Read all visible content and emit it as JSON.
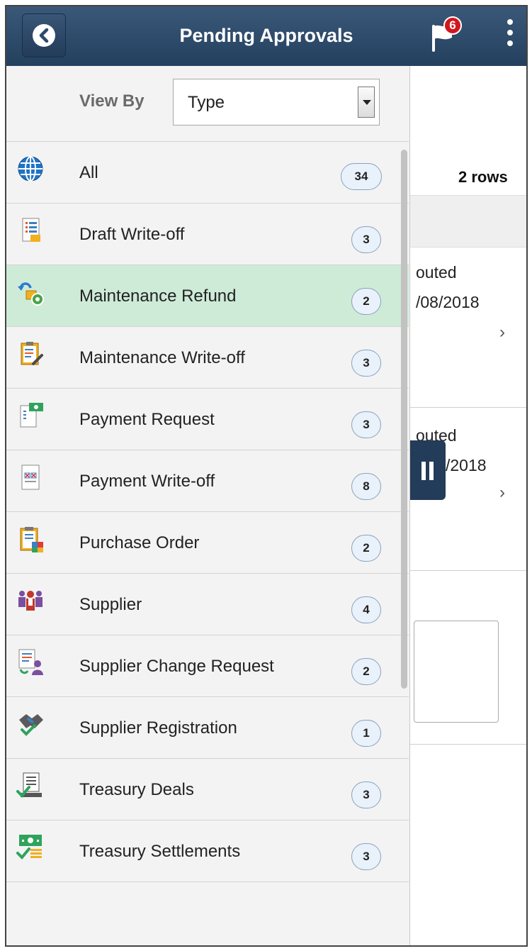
{
  "header": {
    "title": "Pending Approvals",
    "notification_count": "6"
  },
  "view_by": {
    "label": "View By",
    "selected": "Type"
  },
  "background": {
    "rows_count": "2 rows",
    "row1_line1": "outed",
    "row1_line2": "/08/2018",
    "row2_line1": "outed",
    "row2_line2": "/2018"
  },
  "items": [
    {
      "label": "All",
      "count": "34",
      "icon": "globe-icon"
    },
    {
      "label": "Draft Write-off",
      "count": "3",
      "icon": "document-list-icon"
    },
    {
      "label": "Maintenance Refund",
      "count": "2",
      "icon": "refund-icon",
      "selected": true
    },
    {
      "label": "Maintenance Write-off",
      "count": "3",
      "icon": "clipboard-wrench-icon"
    },
    {
      "label": "Payment Request",
      "count": "3",
      "icon": "payment-request-icon"
    },
    {
      "label": "Payment Write-off",
      "count": "8",
      "icon": "payment-writeoff-icon"
    },
    {
      "label": "Purchase Order",
      "count": "2",
      "icon": "purchase-order-icon"
    },
    {
      "label": "Supplier",
      "count": "4",
      "icon": "supplier-group-icon"
    },
    {
      "label": "Supplier Change Request",
      "count": "2",
      "icon": "supplier-change-icon"
    },
    {
      "label": "Supplier Registration",
      "count": "1",
      "icon": "handshake-icon"
    },
    {
      "label": "Treasury Deals",
      "count": "3",
      "icon": "treasury-deals-icon"
    },
    {
      "label": "Treasury Settlements",
      "count": "3",
      "icon": "treasury-settlements-icon"
    }
  ],
  "colors": {
    "header": "#2c4a6b",
    "selected_row": "#cdebd7",
    "badge": "#d2161e"
  }
}
